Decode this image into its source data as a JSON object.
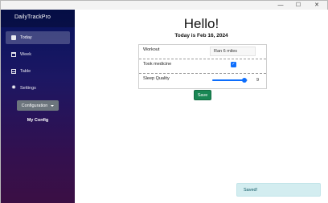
{
  "window": {
    "minimize_glyph": "—",
    "maximize_glyph": "☐",
    "close_glyph": "✕"
  },
  "sidebar": {
    "brand": "DailyTrackPro",
    "items": [
      {
        "label": "Today",
        "icon": "day-icon",
        "active": true
      },
      {
        "label": "Week",
        "icon": "calendar-icon",
        "active": false
      },
      {
        "label": "Table",
        "icon": "table-icon",
        "active": false
      },
      {
        "label": "Settings",
        "icon": "gear-icon",
        "active": false
      }
    ],
    "config_button": "Configuration",
    "config_name": "My Config"
  },
  "main": {
    "greeting": "Hello!",
    "date_text": "Today is Feb 16, 2024",
    "form": {
      "workout_label": "Workout",
      "workout_value": "Ran 6 miles",
      "medicine_label": "Took medicine",
      "medicine_checked": true,
      "sleep_label": "Sleep Quality",
      "sleep_value": "9",
      "sleep_min": 0,
      "sleep_max": 10
    },
    "save_label": "Save",
    "toast": "Saved!"
  },
  "colors": {
    "sidebar_top": "#06135d",
    "sidebar_bottom": "#3b0f44",
    "primary": "#0d6efd",
    "success": "#198754",
    "toast_bg": "#d3edf0"
  }
}
